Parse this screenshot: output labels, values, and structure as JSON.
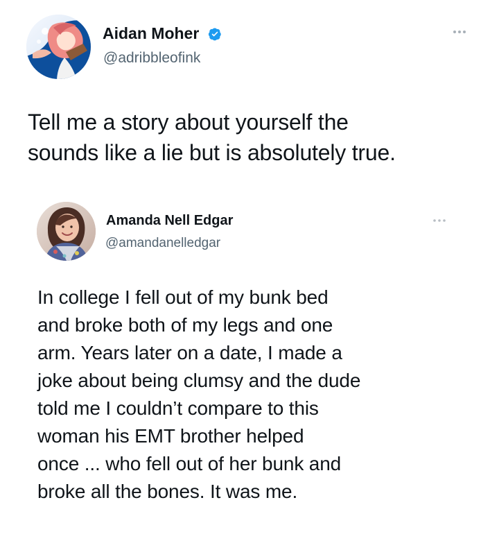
{
  "main_post": {
    "author_name": "Aidan Moher",
    "handle": "@adribbleofink",
    "verified": true,
    "text_lines": [
      "Tell me a story about yourself the",
      "sounds like a lie but is absolutely true."
    ]
  },
  "reply_post": {
    "author_name": "Amanda Nell Edgar",
    "handle": "@amandanelledgar",
    "text_lines": [
      "In college I fell out of my bunk bed",
      "and broke both of my legs and one",
      "arm. Years later on a date, I made a",
      "joke about being clumsy and the dude",
      "told me I couldn’t compare to this",
      "woman his EMT brother helped",
      "once ... who fell out of her bunk and",
      "broke all the bones. It was me."
    ]
  },
  "colors": {
    "text": "#0f1419",
    "secondary_text": "#536471",
    "verified_blue": "#1d9bf0"
  },
  "icons": {
    "more_options": "more-options-icon",
    "verified_badge": "verified-badge-icon"
  }
}
